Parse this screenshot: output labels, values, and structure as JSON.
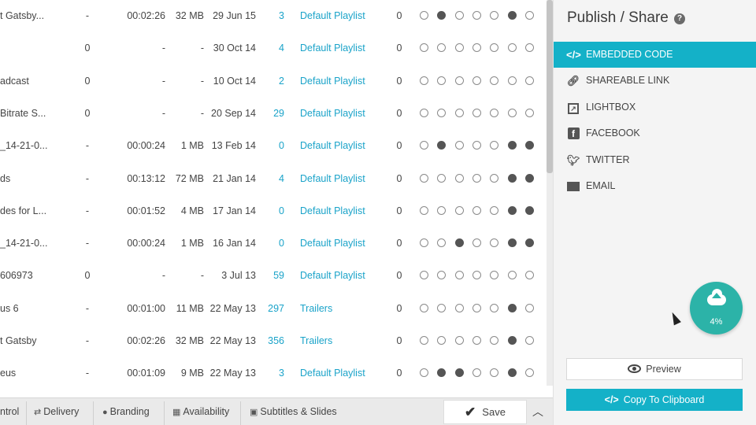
{
  "table": {
    "rows": [
      {
        "name": "t Gatsby...",
        "a": "-",
        "dur": "00:02:26",
        "size": "32 MB",
        "date": "29 Jun 15",
        "count": "3",
        "playlist": "Default Playlist",
        "zero": "0",
        "dots": [
          0,
          1,
          0,
          0,
          0,
          1,
          0
        ]
      },
      {
        "name": "",
        "a": "0",
        "dur": "-",
        "size": "-",
        "date": "30 Oct 14",
        "count": "4",
        "playlist": "Default Playlist",
        "zero": "0",
        "dots": [
          0,
          0,
          0,
          0,
          0,
          0,
          0
        ]
      },
      {
        "name": "adcast",
        "a": "0",
        "dur": "-",
        "size": "-",
        "date": "10 Oct 14",
        "count": "2",
        "playlist": "Default Playlist",
        "zero": "0",
        "dots": [
          0,
          0,
          0,
          0,
          0,
          0,
          0
        ]
      },
      {
        "name": "Bitrate S...",
        "a": "0",
        "dur": "-",
        "size": "-",
        "date": "20 Sep 14",
        "count": "29",
        "playlist": "Default Playlist",
        "zero": "0",
        "dots": [
          0,
          0,
          0,
          0,
          0,
          0,
          0
        ]
      },
      {
        "name": "_14-21-0...",
        "a": "-",
        "dur": "00:00:24",
        "size": "1 MB",
        "date": "13 Feb 14",
        "count": "0",
        "playlist": "Default Playlist",
        "zero": "0",
        "dots": [
          0,
          1,
          0,
          0,
          0,
          1,
          1
        ]
      },
      {
        "name": "ds",
        "a": "-",
        "dur": "00:13:12",
        "size": "72 MB",
        "date": "21 Jan 14",
        "count": "4",
        "playlist": "Default Playlist",
        "zero": "0",
        "dots": [
          0,
          0,
          0,
          0,
          0,
          1,
          1
        ]
      },
      {
        "name": "des for L...",
        "a": "-",
        "dur": "00:01:52",
        "size": "4 MB",
        "date": "17 Jan 14",
        "count": "0",
        "playlist": "Default Playlist",
        "zero": "0",
        "dots": [
          0,
          0,
          0,
          0,
          0,
          1,
          1
        ]
      },
      {
        "name": "_14-21-0...",
        "a": "-",
        "dur": "00:00:24",
        "size": "1 MB",
        "date": "16 Jan 14",
        "count": "0",
        "playlist": "Default Playlist",
        "zero": "0",
        "dots": [
          0,
          0,
          1,
          0,
          0,
          1,
          1
        ]
      },
      {
        "name": "606973",
        "a": "0",
        "dur": "-",
        "size": "-",
        "date": "3 Jul 13",
        "count": "59",
        "playlist": "Default Playlist",
        "zero": "0",
        "dots": [
          0,
          0,
          0,
          0,
          0,
          0,
          0
        ]
      },
      {
        "name": "us 6",
        "a": "-",
        "dur": "00:01:00",
        "size": "11 MB",
        "date": "22 May 13",
        "count": "297",
        "playlist": "Trailers",
        "zero": "0",
        "dots": [
          0,
          0,
          0,
          0,
          0,
          1,
          0
        ]
      },
      {
        "name": "t Gatsby",
        "a": "-",
        "dur": "00:02:26",
        "size": "32 MB",
        "date": "22 May 13",
        "count": "356",
        "playlist": "Trailers",
        "zero": "0",
        "dots": [
          0,
          0,
          0,
          0,
          0,
          1,
          0
        ]
      },
      {
        "name": "eus",
        "a": "-",
        "dur": "00:01:09",
        "size": "9 MB",
        "date": "22 May 13",
        "count": "3",
        "playlist": "Default Playlist",
        "zero": "0",
        "dots": [
          0,
          1,
          1,
          0,
          0,
          1,
          0
        ]
      }
    ]
  },
  "tabs": {
    "control": "ntrol",
    "delivery": "Delivery",
    "branding": "Branding",
    "availability": "Availability",
    "subtitles": "Subtitles & Slides",
    "save": "Save"
  },
  "icons": {
    "delivery": "shuffle-icon",
    "branding": "person-icon",
    "availability": "calendar-icon",
    "subtitles": "cc-icon",
    "save": "checkmark-icon",
    "collapse": "chevron-up-icon"
  },
  "panel": {
    "title": "Publish / Share",
    "menu": [
      {
        "label": "EMBEDDED CODE",
        "icon": "code-icon",
        "active": true
      },
      {
        "label": "SHAREABLE LINK",
        "icon": "link-icon",
        "active": false
      },
      {
        "label": "LIGHTBOX",
        "icon": "external-icon",
        "active": false
      },
      {
        "label": "FACEBOOK",
        "icon": "facebook-icon",
        "active": false
      },
      {
        "label": "TWITTER",
        "icon": "twitter-icon",
        "active": false
      },
      {
        "label": "EMAIL",
        "icon": "envelope-icon",
        "active": false
      }
    ],
    "upload_percent": "4%",
    "preview_label": "Preview",
    "copy_label": "Copy To Clipboard"
  },
  "colors": {
    "accent": "#14b1c8",
    "link": "#1aa3c9",
    "upload": "#2cb3a8"
  }
}
